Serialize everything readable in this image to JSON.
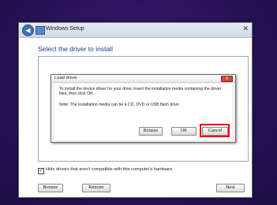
{
  "setup_window": {
    "title": "Windows Setup",
    "heading": "Select the driver to install",
    "hide_checkbox_label": "Hide drivers that aren't compatible with this computer's hardware.",
    "hide_checkbox_checked": true,
    "buttons": {
      "browse": "Browse",
      "rescan": "Rescan",
      "next": "Next"
    }
  },
  "load_driver_dialog": {
    "title": "Load driver",
    "close_label": "X",
    "message": "To install the device driver for your drive, insert the installation media containing the driver files, then click OK.",
    "note": "Note: The installation media can be a CD, DVD or USB flash drive.",
    "buttons": {
      "browse": "Browse",
      "ok": "OK",
      "cancel": "Cancel"
    }
  },
  "highlight_color": "#e0141a"
}
